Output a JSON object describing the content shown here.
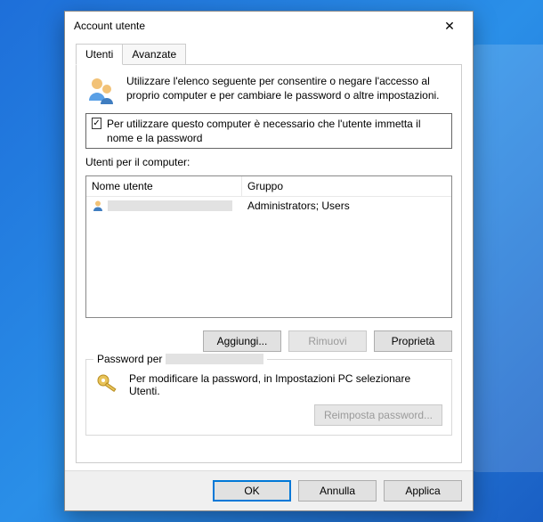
{
  "dialog": {
    "title": "Account utente",
    "close_glyph": "✕"
  },
  "tabs": {
    "users": "Utenti",
    "advanced": "Avanzate"
  },
  "intro": "Utilizzare l'elenco seguente per consentire o negare l'accesso al proprio computer e per cambiare le password o altre impostazioni.",
  "checkbox": {
    "label": "Per utilizzare questo computer è necessario che l'utente immetta il nome e la password",
    "check_glyph": "✓"
  },
  "userlist": {
    "caption": "Utenti per il computer:",
    "col_user": "Nome utente",
    "col_group": "Gruppo",
    "rows": [
      {
        "group": "Administrators; Users"
      }
    ]
  },
  "buttons": {
    "add": "Aggiungi...",
    "remove": "Rimuovi",
    "properties": "Proprietà"
  },
  "password_group": {
    "label_prefix": "Password per",
    "text": "Per modificare la password, in Impostazioni PC selezionare Utenti.",
    "reset": "Reimposta password..."
  },
  "footer": {
    "ok": "OK",
    "cancel": "Annulla",
    "apply": "Applica"
  }
}
